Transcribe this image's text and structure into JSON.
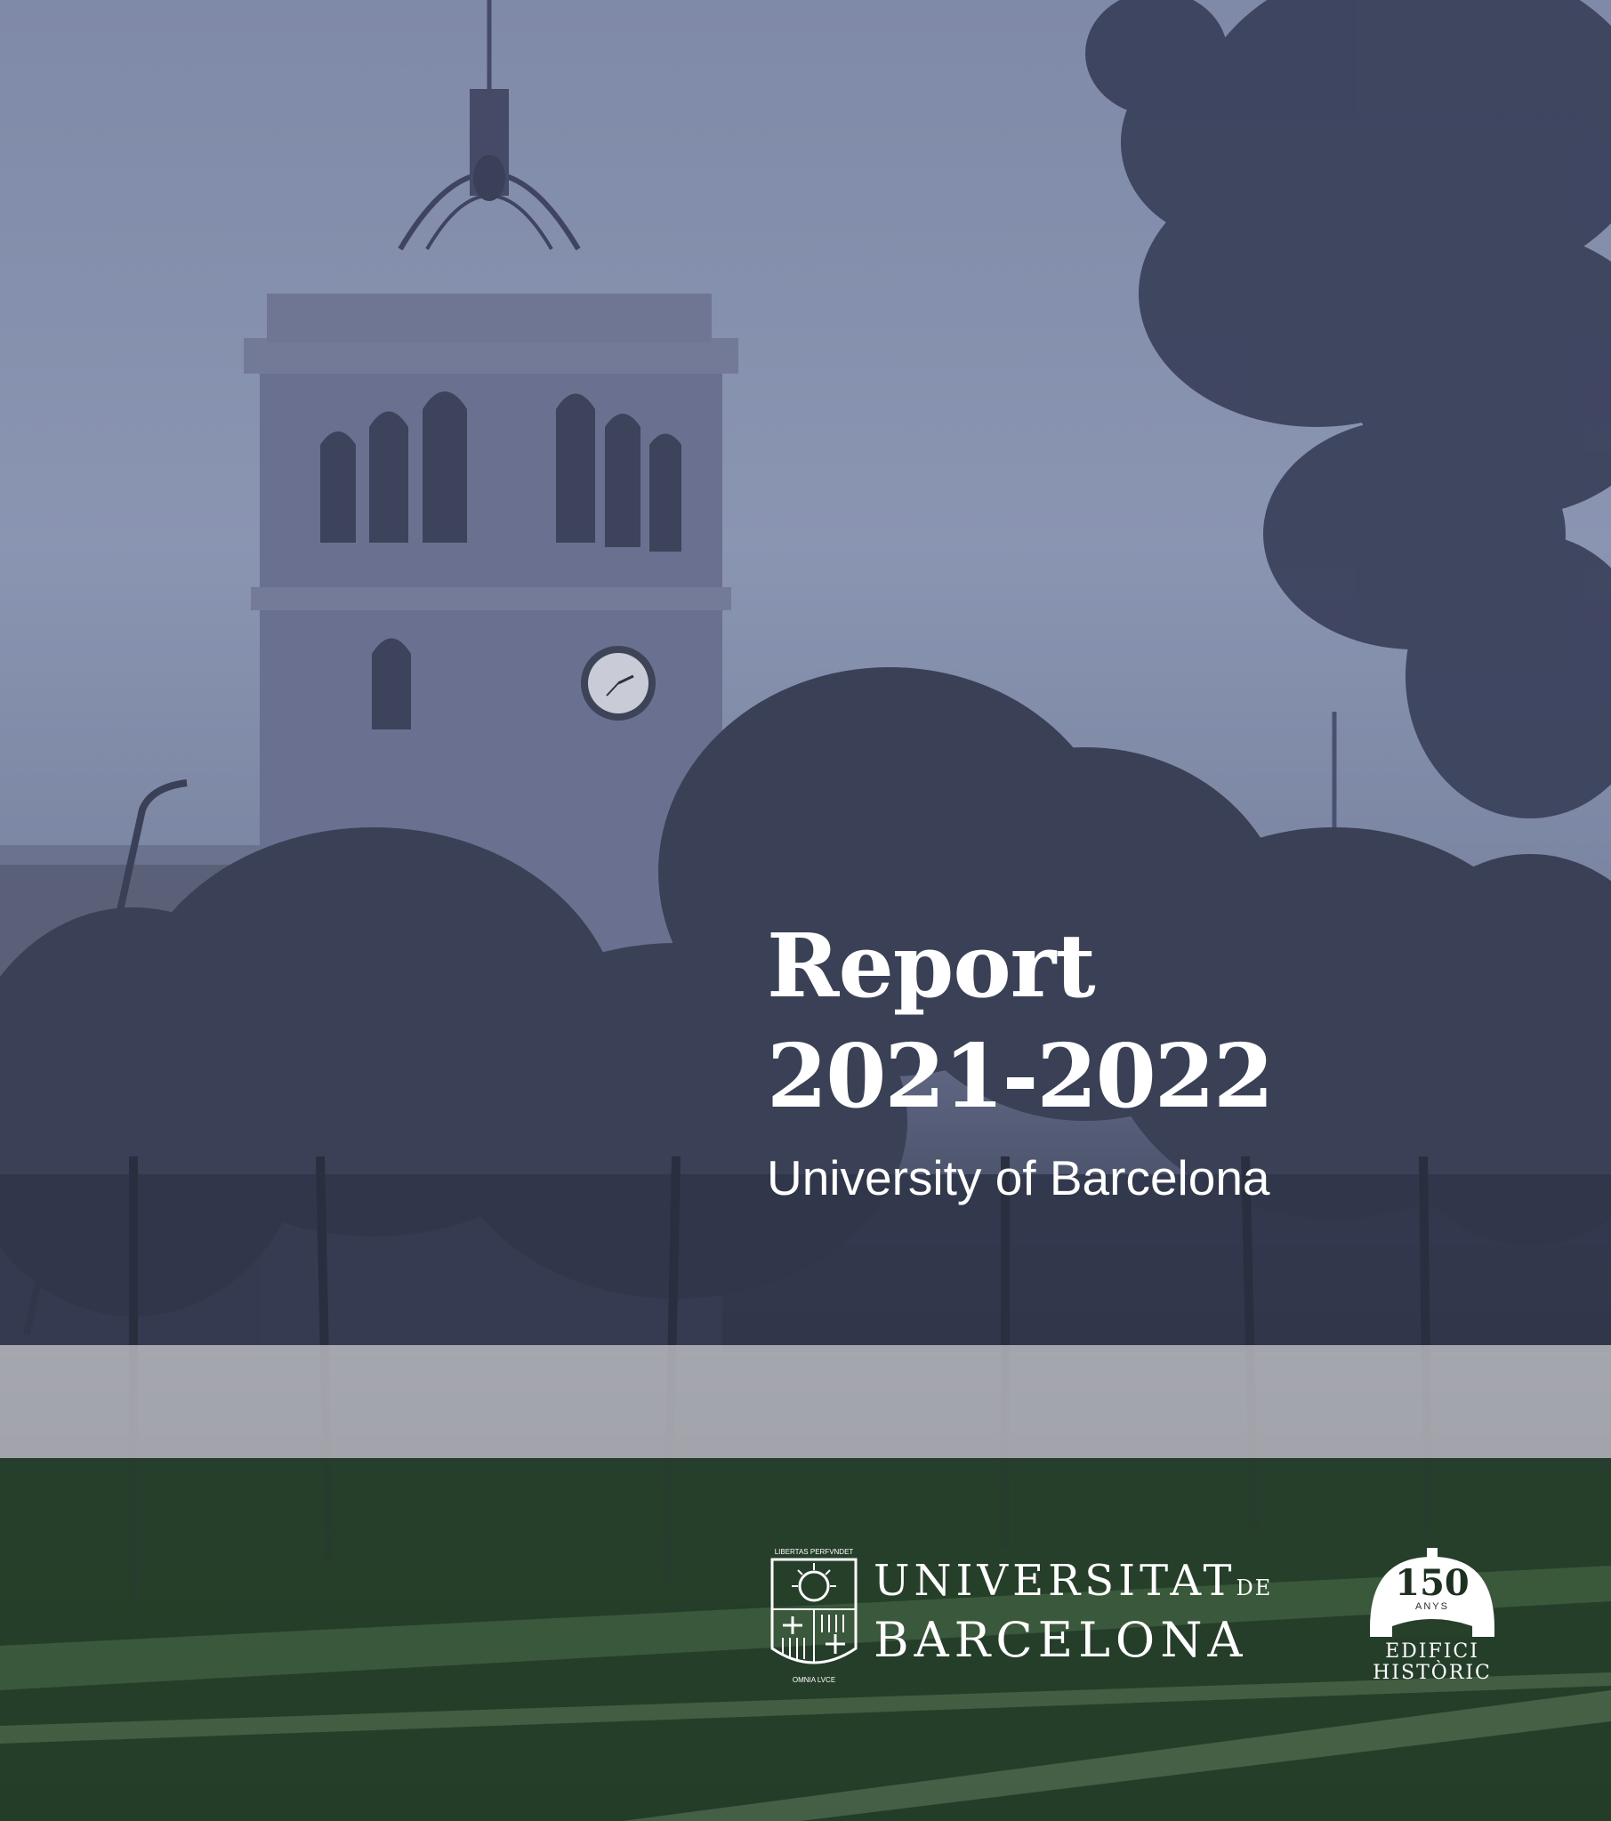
{
  "cover": {
    "title_line1": "Report",
    "title_line2": "2021-2022",
    "subtitle": "University of Barcelona"
  },
  "logo": {
    "seal_motto_top": "LIBERTAS PERFVNDET",
    "seal_motto_bottom": "OMNIA LVCE",
    "name_line1": "UNIVERSITAT",
    "name_de": "DE",
    "name_line2": "BARCELONA"
  },
  "badge": {
    "anniversary": "150",
    "anys": "ANYS",
    "line1": "EDIFICI",
    "line2": "HISTÒRIC"
  },
  "colors": {
    "sky": "#8a95b2",
    "band": "#c4c4c8",
    "green_overlay": "#27402a",
    "text": "#ffffff"
  }
}
